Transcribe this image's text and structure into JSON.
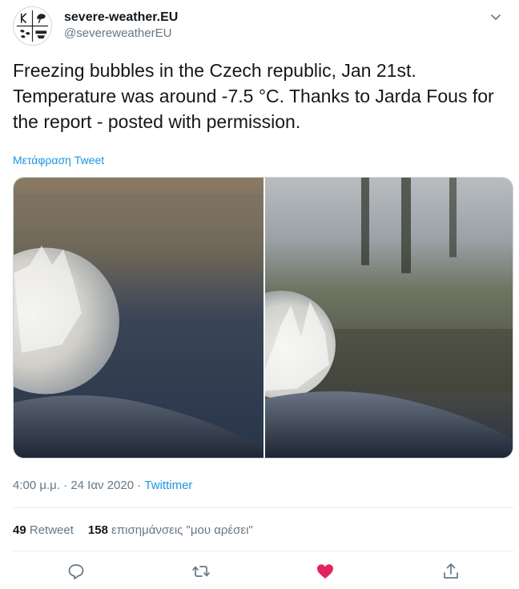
{
  "author": {
    "display_name": "severe-weather.EU",
    "handle": "@severeweatherEU"
  },
  "tweet": {
    "text": "Freezing bubbles in the Czech republic, Jan 21st. Temperature was around -7.5 °C. Thanks to Jarda Fous for the report - posted with permission.",
    "translate_label": "Μετάφραση Tweet"
  },
  "meta": {
    "time": "4:00 μ.μ.",
    "separator": " · ",
    "date": "24 Ιαν 2020",
    "source": "Twittimer"
  },
  "stats": {
    "retweets_count": "49",
    "retweets_label": "Retweet",
    "likes_count": "158",
    "likes_label": "επισημάνσεις \"μου αρέσει\""
  },
  "icons": {
    "caret": "chevron-down-icon",
    "reply": "reply-icon",
    "retweet": "retweet-icon",
    "like": "heart-icon",
    "share": "share-icon"
  },
  "colors": {
    "accent": "#1b95e0",
    "like": "#e0245e",
    "muted": "#657786",
    "text": "#14171a"
  }
}
